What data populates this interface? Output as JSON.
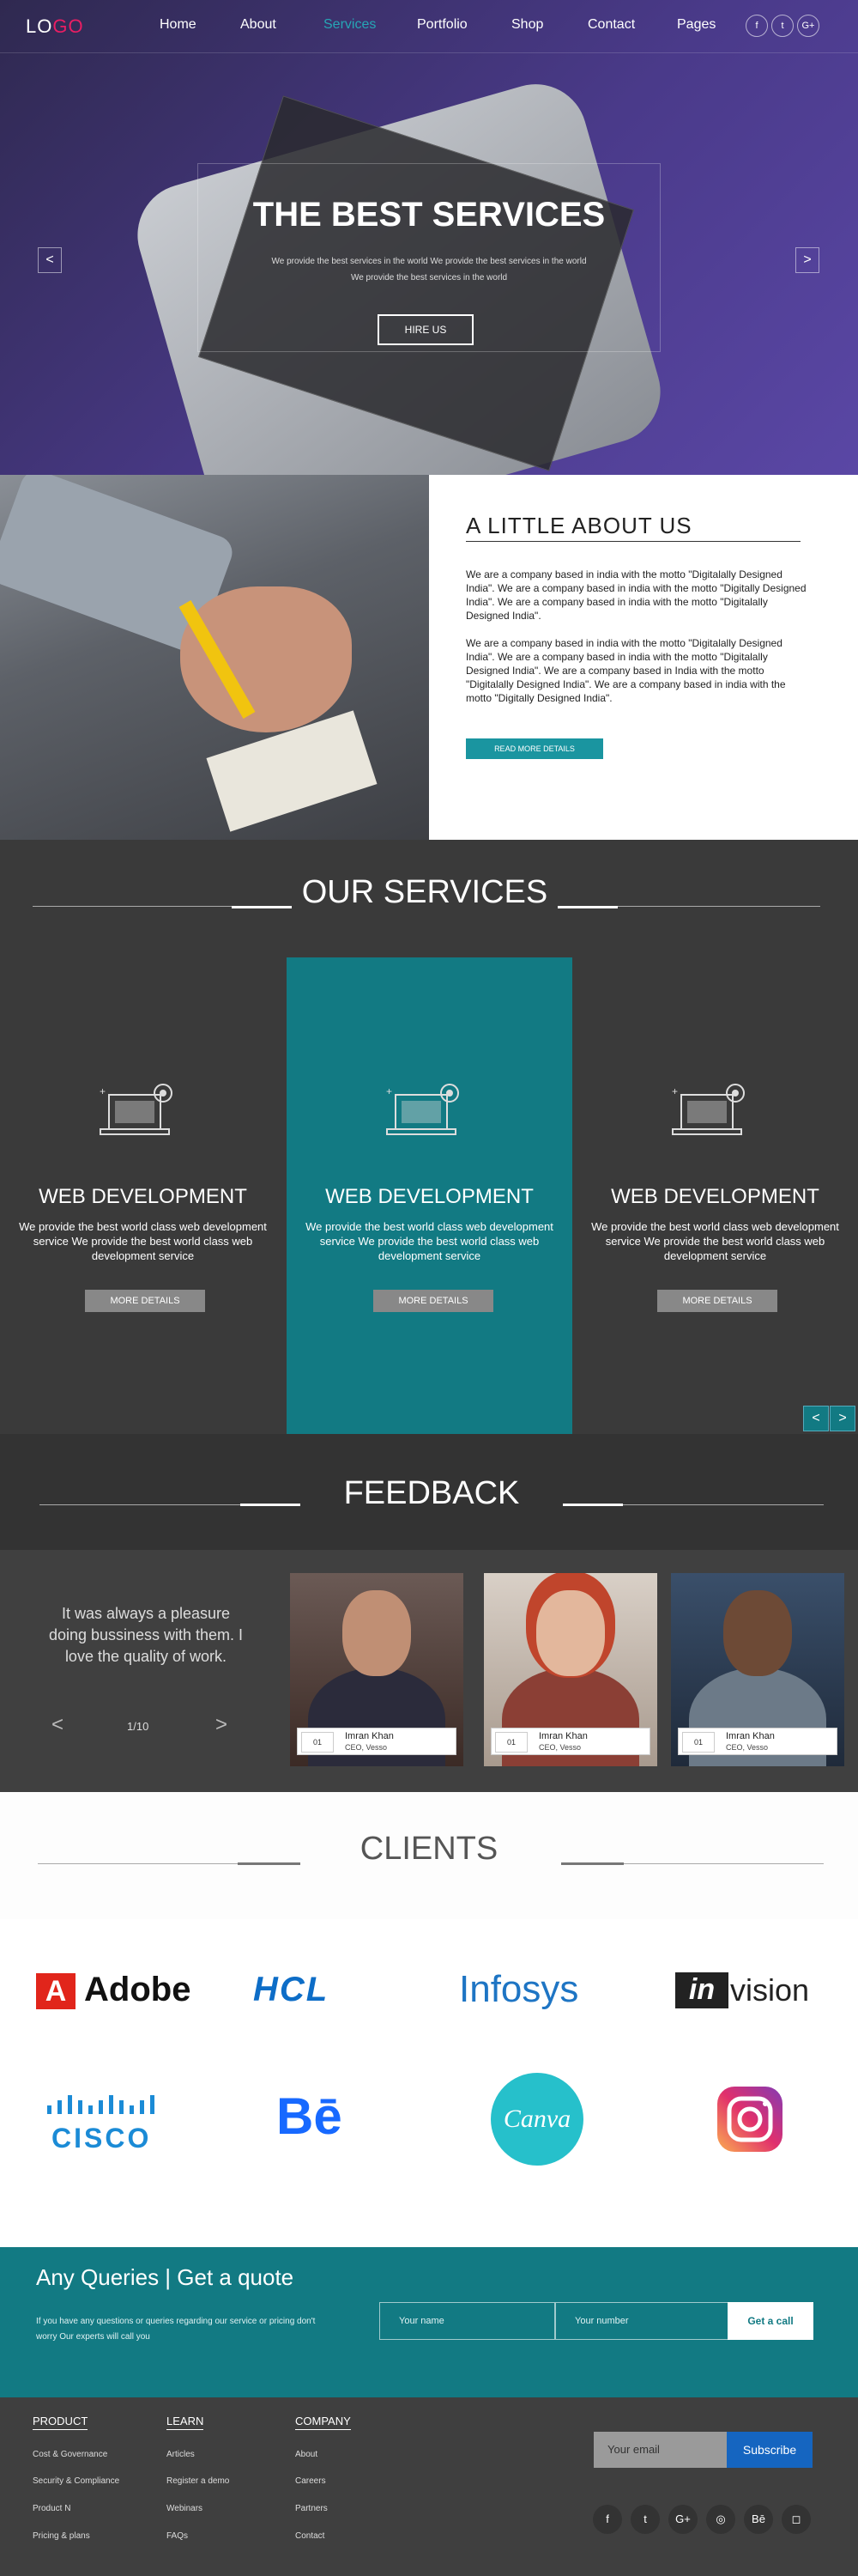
{
  "nav": {
    "logo_lo": "LO",
    "logo_go": "GO",
    "links": [
      "Home",
      "About",
      "Services",
      "Portfolio",
      "Shop",
      "Contact",
      "Pages"
    ],
    "social_icons": [
      "facebook-icon",
      "twitter-icon",
      "google-plus-icon"
    ],
    "social_glyphs": [
      "f",
      "t",
      "G+"
    ]
  },
  "hero": {
    "title": "THE BEST SERVICES",
    "sub1": "We provide the best services in the world We provide the best services in the world",
    "sub2": "We provide the best services in the world",
    "button": "HIRE US",
    "prev": "<",
    "next": ">"
  },
  "about": {
    "title": "A LITTLE ABOUT US",
    "p1": "We are  a company based in india with the motto \"Digitalally Designed India\". We are  a company based in india with the motto \"Digitally  Designed India\". We are  a company based in india with the motto \"Digitalally  Designed India\".",
    "p2": "We are  a company based in india with the motto \"Digitalally Designed India\". We are  a company based in india with the motto \"Digitalally Designed India\".  We are  a company based in India with the motto \"Digitalally Designed India\".  We are  a company based in india with the motto \"Digitally Designed India\".",
    "button": "READ MORE DETAILS"
  },
  "services": {
    "title": "OUR SERVICES",
    "items": [
      {
        "title": "WEB DEVELOPMENT",
        "text": "We provide the best world class web development service We provide the best world class web development service",
        "button": "MORE DETAILS"
      },
      {
        "title": "WEB DEVELOPMENT",
        "text": "We provide the best world class web development service We provide the best world class web development service",
        "button": "MORE DETAILS"
      },
      {
        "title": "WEB DEVELOPMENT",
        "text": "We provide the best world class web development service We provide the best world class web development service",
        "button": "MORE DETAILS"
      }
    ],
    "prev": "<",
    "next": ">"
  },
  "feedback": {
    "title": "FEEDBACK",
    "quote": "It was always a pleasure doing bussiness with them. I love the quality of work.",
    "counter": "1/10",
    "prev": "<",
    "next": ">",
    "people": [
      {
        "num": "01",
        "name": "Imran Khan",
        "role": "CEO, Vesso"
      },
      {
        "num": "01",
        "name": "Imran Khan",
        "role": "CEO, Vesso"
      },
      {
        "num": "01",
        "name": "Imran Khan",
        "role": "CEO, Vesso"
      }
    ]
  },
  "clients": {
    "title": "CLIENTS",
    "logos": [
      "Adobe",
      "HCL",
      "Infosys",
      "invision",
      "CISCO",
      "Bē",
      "Canva",
      "instagram-icon"
    ],
    "invision_in": "in",
    "invision_rest": "vision",
    "adobe_mark": "A"
  },
  "quote": {
    "title": "Any Queries | Get a quote",
    "text": "If you have any questions or queries regarding our service or pricing don't worry Our experts will call you",
    "name_placeholder": "Your name",
    "number_placeholder": "Your number",
    "button": "Get a call"
  },
  "footer": {
    "columns": [
      {
        "title": "PRODUCT",
        "links": [
          "Cost & Governance",
          "Security & Compliance",
          "Product N",
          "Pricing & plans"
        ]
      },
      {
        "title": "LEARN",
        "links": [
          "Articles",
          "Register a demo",
          "Webinars",
          "FAQs"
        ]
      },
      {
        "title": "COMPANY",
        "links": [
          "About",
          "Careers",
          "Partners",
          "Contact"
        ]
      }
    ],
    "email_placeholder": "Your email",
    "subscribe": "Subscribe",
    "social_icons": [
      "facebook-icon",
      "twitter-icon",
      "google-plus-icon",
      "dribbble-icon",
      "behance-icon",
      "instagram-icon"
    ],
    "social_glyphs": [
      "f",
      "t",
      "G+",
      "◎",
      "Bē",
      "◻"
    ]
  }
}
